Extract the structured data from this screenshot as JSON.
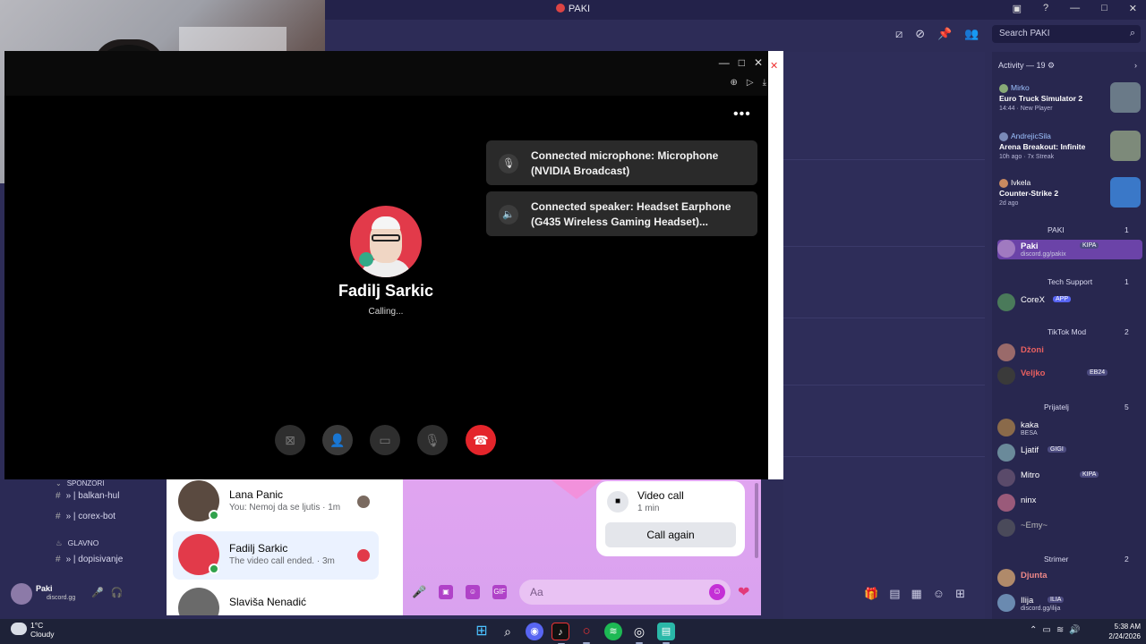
{
  "discord": {
    "title": "PAKI",
    "search_placeholder": "Search PAKI",
    "activity_header": "Activity — 19",
    "activities": [
      {
        "user": "Mirko",
        "extra": "2",
        "game": "Euro Truck Simulator 2",
        "meta": "14:44 · New Player"
      },
      {
        "user": "AndrejicSila",
        "extra": "",
        "game": "Arena Breakout: Infinite",
        "meta": "10h ago · 7x Streak"
      },
      {
        "user": "Ivkela",
        "extra": "2",
        "game": "Counter-Strike 2",
        "meta": "2d ago"
      }
    ],
    "roles": [
      {
        "name": "PAKI",
        "count": "1"
      },
      {
        "name": "Tech Support",
        "count": "1"
      },
      {
        "name": "TikTok Mod",
        "count": "2"
      },
      {
        "name": "Prijatelj",
        "count": "5"
      },
      {
        "name": "Strimer",
        "count": "2"
      }
    ],
    "members": [
      {
        "name": "Paki",
        "sub": "discord.gg/pakix",
        "badge": "KIPA"
      },
      {
        "name": "CoreX",
        "sub": "",
        "badge": "APP"
      },
      {
        "name": "Džoni",
        "sub": "",
        "badge": ""
      },
      {
        "name": "Veljko",
        "sub": "",
        "badge": "EB24"
      },
      {
        "name": "kaka",
        "sub": "BESA",
        "badge": ""
      },
      {
        "name": "Ljatif",
        "sub": "",
        "badge": "GIGI"
      },
      {
        "name": "Mitro",
        "sub": "",
        "badge": "KIPA"
      },
      {
        "name": "ninx",
        "sub": "",
        "badge": ""
      },
      {
        "name": "~Emy~",
        "sub": "",
        "badge": ""
      },
      {
        "name": "Djunta",
        "sub": "",
        "badge": ""
      },
      {
        "name": "Ilija",
        "sub": "discord.gg/ilija",
        "badge": "ILIA"
      }
    ],
    "channels": [
      {
        "name": "SPONZORI",
        "category": true
      },
      {
        "name": "» | balkan-hul",
        "category": false
      },
      {
        "name": "» | corex-bot",
        "category": false
      },
      {
        "name": "GLAVNO",
        "category": true
      },
      {
        "name": "» | dopisivanje",
        "category": false
      }
    ],
    "user_panel": {
      "name": "Paki",
      "sub": "discord.gg"
    }
  },
  "call": {
    "more_label": "•••",
    "toasts": [
      {
        "icon": "microphone-icon",
        "text": "Connected microphone: Microphone (NVIDIA Broadcast)"
      },
      {
        "icon": "speaker-icon",
        "text": "Connected speaker: Headset Earphone (G435 Wireless Gaming Headset)..."
      }
    ],
    "callee_name": "Fadilj Sarkic",
    "status": "Calling..."
  },
  "messenger": {
    "conversations": [
      {
        "name": "Lana Panic",
        "preview": "You: Nemoj da se ljutis · 1m",
        "active": false
      },
      {
        "name": "Fadilj Sarkic",
        "preview": "The video call ended. · 3m",
        "active": true
      },
      {
        "name": "Slaviša Nenadić",
        "preview": "",
        "active": false
      }
    ],
    "video_card": {
      "title": "Video call",
      "duration": "1 min",
      "button": "Call again"
    },
    "composer_placeholder": "Aa"
  },
  "taskbar": {
    "weather_temp": "1°C",
    "weather_desc": "Cloudy",
    "time": "5:38 AM",
    "date": "2/24/2026"
  },
  "colors": {
    "end_call": "#e4252b",
    "messenger_accent": "#b042c8",
    "discord_bg": "#2d2c57"
  }
}
